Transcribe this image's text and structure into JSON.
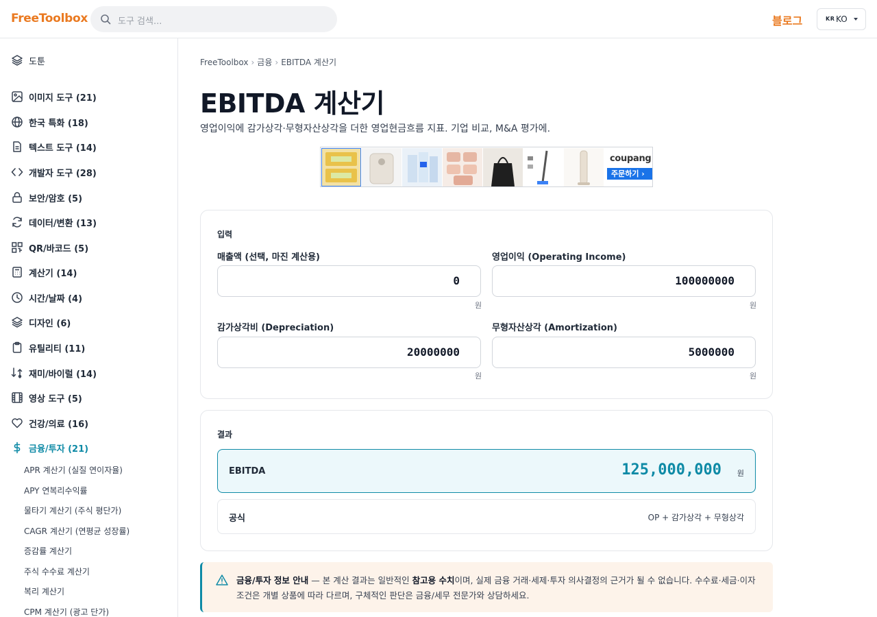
{
  "header": {
    "logo": "FreeToolbox",
    "search_placeholder": "도구 검색...",
    "blog_link": "블로그",
    "lang_flag": "KR",
    "lang_code": "KO"
  },
  "sidebar": {
    "items": [
      {
        "label": "도툰",
        "icon": "layers-icon"
      },
      {
        "label": "이미지 도구 (21)",
        "icon": "image-icon"
      },
      {
        "label": "한국 특화 (18)",
        "icon": "globe-icon"
      },
      {
        "label": "텍스트 도구 (14)",
        "icon": "document-icon"
      },
      {
        "label": "개발자 도구 (28)",
        "icon": "code-icon"
      },
      {
        "label": "보안/암호 (5)",
        "icon": "lock-icon"
      },
      {
        "label": "데이터/변환 (13)",
        "icon": "refresh-icon"
      },
      {
        "label": "QR/바코드 (5)",
        "icon": "qr-icon"
      },
      {
        "label": "계산기 (14)",
        "icon": "calculator-icon"
      },
      {
        "label": "시간/날짜 (4)",
        "icon": "clock-icon"
      },
      {
        "label": "디자인 (6)",
        "icon": "layers-icon"
      },
      {
        "label": "유틸리티 (11)",
        "icon": "clipboard-icon"
      },
      {
        "label": "재미/바이럴 (14)",
        "icon": "shuffle-icon"
      },
      {
        "label": "영상 도구 (5)",
        "icon": "film-icon"
      },
      {
        "label": "건강/의료 (16)",
        "icon": "heart-icon"
      },
      {
        "label": "금융/투자 (21)",
        "icon": "dollar-icon"
      }
    ],
    "subitems": [
      "APR 계산기 (실질 연이자율)",
      "APY 연복리수익률",
      "물타기 계산기 (주식 평단가)",
      "CAGR 계산기 (연평균 성장률)",
      "증감률 계산기",
      "주식 수수료 계산기",
      "복리 계산기",
      "CPM 계산기 (광고 단가)"
    ]
  },
  "breadcrumb": {
    "home": "FreeToolbox",
    "category": "금융",
    "current": "EBITDA 계산기",
    "separator": "›"
  },
  "page": {
    "title": "EBITDA 계산기",
    "description": "영업이익에 감가상각·무형자산상각을 더한 영업현금흐름 지표. 기업 비교, M&A 평가에."
  },
  "ad": {
    "brand": "coupang",
    "button": "주문하기 ›"
  },
  "input_card": {
    "title": "입력",
    "unit": "원",
    "fields": [
      {
        "label": "매출액 (선택, 마진 계산용)",
        "value": "0"
      },
      {
        "label": "영업이익 (Operating Income)",
        "value": "100000000"
      },
      {
        "label": "감가상각비 (Depreciation)",
        "value": "20000000"
      },
      {
        "label": "무형자산상각 (Amortization)",
        "value": "5000000"
      }
    ]
  },
  "result_card": {
    "title": "결과",
    "result_label": "EBITDA",
    "result_value": "125,000,000",
    "result_unit": "원",
    "formula_label": "공식",
    "formula_value": "OP + 감가상각 + 무형상각"
  },
  "notice": {
    "title": "금융/투자 정보 안내",
    "text_1": " — 본 계산 결과는 일반적인 ",
    "emphasis": "참고용 수치",
    "text_2": "이며, 실제 금융 거래·세제·투자 의사결정의 근거가 될 수 없습니다. 수수료·세금·이자 조건은 개별 상품에 따라 다르며, 구체적인 판단은 금융/세무 전문가와 상담하세요."
  },
  "colors": {
    "brand": "#ea7a21",
    "accent": "#0e8aa6",
    "notice_bg": "#fdf3ea"
  }
}
